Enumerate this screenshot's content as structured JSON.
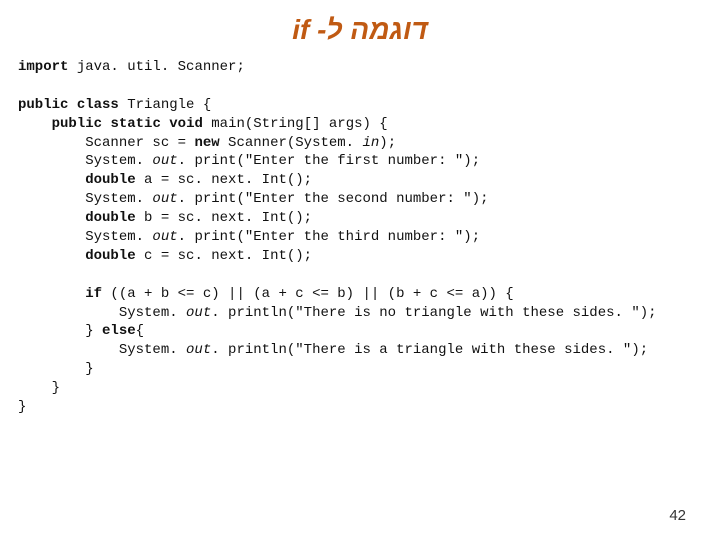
{
  "title": "דוגמה ל- if",
  "code": {
    "kw_import": "import",
    "l1_rest": " java. util. Scanner;",
    "kw_public1": "public",
    "kw_class": "class",
    "l3_rest": " Triangle {",
    "kw_public2": "public",
    "kw_static": "static",
    "kw_void": "void",
    "l4_rest": " main(String[] args) {",
    "l5_a": "        Scanner sc = ",
    "kw_new": "new",
    "l5_b": " Scanner(System. ",
    "it_in": "in",
    "l5_c": ");",
    "l6_a": "        System. ",
    "it_out1": "out",
    "l6_b": ". print(\"Enter the first number: \");",
    "kw_double1": "double",
    "l7_rest": " a = sc. next. Int();",
    "l8_a": "        System. ",
    "it_out2": "out",
    "l8_b": ". print(\"Enter the second number: \");",
    "kw_double2": "double",
    "l9_rest": " b = sc. next. Int();",
    "l10_a": "        System. ",
    "it_out3": "out",
    "l10_b": ". print(\"Enter the third number: \");",
    "kw_double3": "double",
    "l11_rest": " c = sc. next. Int();",
    "kw_if": "if",
    "l13_rest": " ((a + b <= c) || (a + c <= b) || (b + c <= a)) {",
    "l14_a": "            System. ",
    "it_out4": "out",
    "l14_b": ". println(\"There is no triangle with these sides. \");",
    "l15_a": "        } ",
    "kw_else": "else",
    "l15_b": "{",
    "l16_a": "            System. ",
    "it_out5": "out",
    "l16_b": ". println(\"There is a triangle with these sides. \");",
    "l17": "        }",
    "l18": "    }",
    "l19": "}"
  },
  "page_number": "42"
}
